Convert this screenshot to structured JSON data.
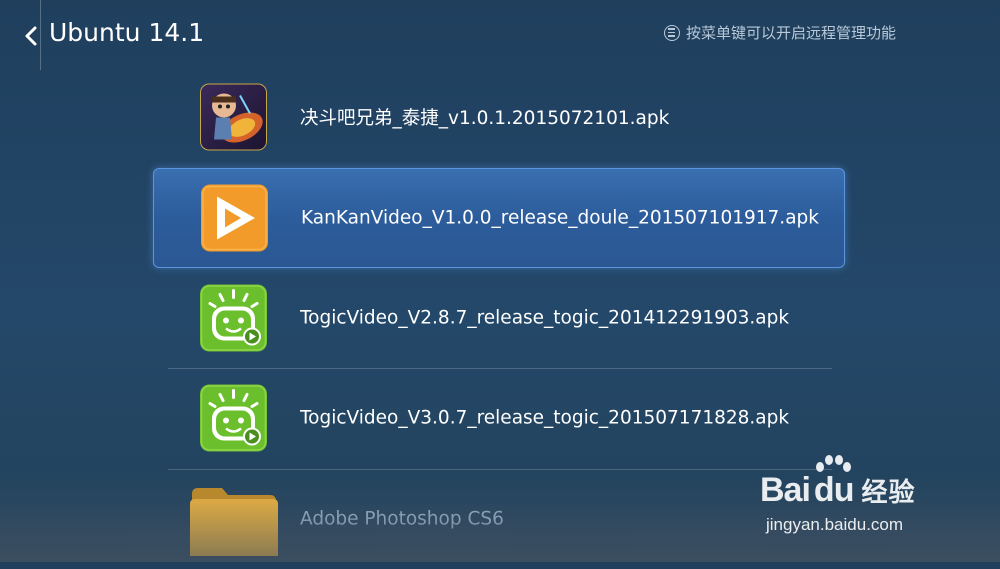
{
  "header": {
    "back_label": "<",
    "title": "Ubuntu 14.1",
    "hint_text": "按菜单键可以开启远程管理功能"
  },
  "files": [
    {
      "name": "决斗吧兄弟_泰捷_v1.0.1.2015072101.apk",
      "icon": "game-app-icon"
    },
    {
      "name": "KanKanVideo_V1.0.0_release_doule_201507101917.apk",
      "icon": "play-video-icon",
      "selected": true
    },
    {
      "name": "TogicVideo_V2.8.7_release_togic_201412291903.apk",
      "icon": "togic-video-icon"
    },
    {
      "name": "TogicVideo_V3.0.7_release_togic_201507171828.apk",
      "icon": "togic-video-icon"
    },
    {
      "name": "Adobe Photoshop CS6",
      "icon": "folder-icon"
    }
  ],
  "watermark": {
    "logo_text": "Bai",
    "logo_du": "du",
    "logo_cn": "经验",
    "sub": "jingyan.baidu.com"
  },
  "colors": {
    "background": "#24486a",
    "selected_row": "#2c5c9b",
    "selected_border": "#5a95e0",
    "orange_icon": "#f29b2a",
    "green_icon": "#6cbf2c"
  }
}
